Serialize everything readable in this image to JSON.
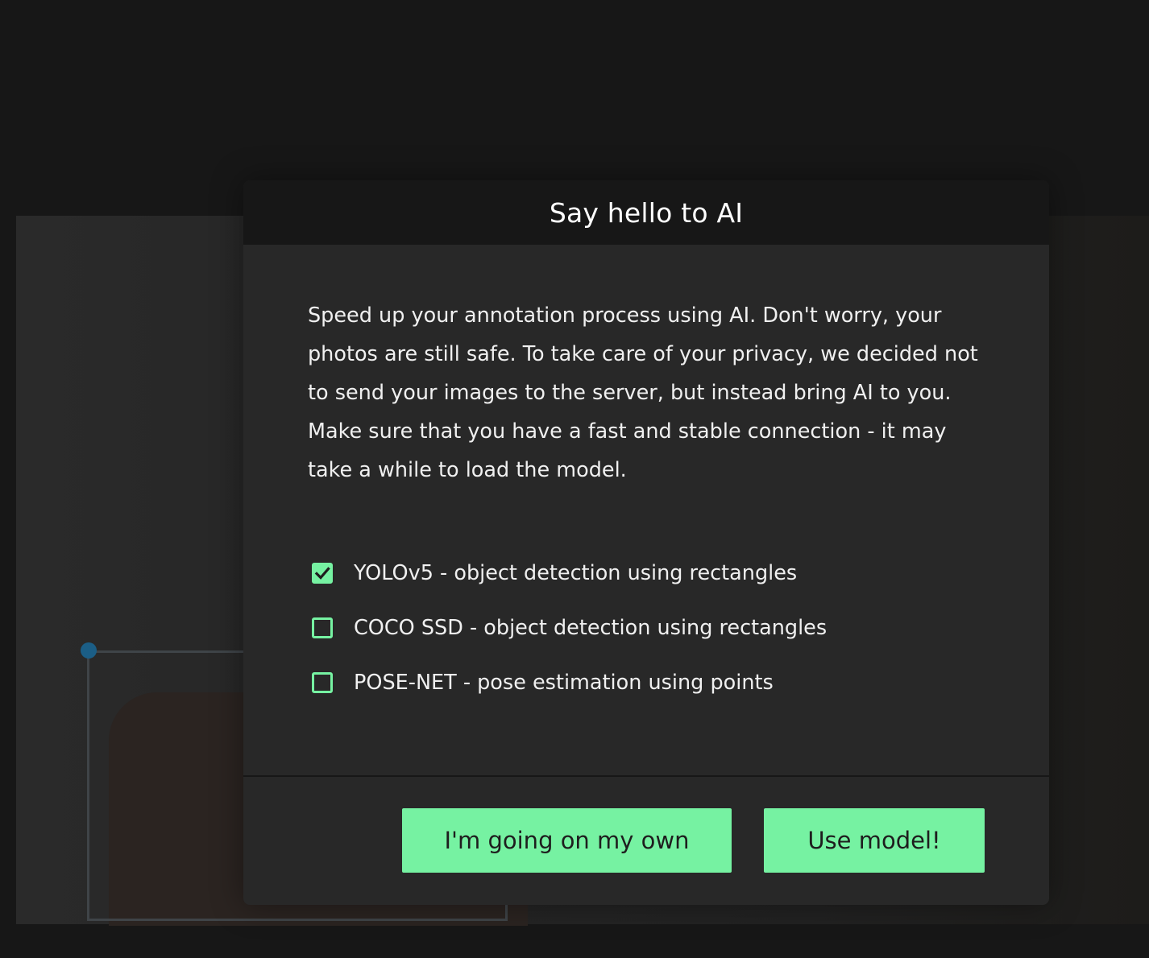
{
  "modal": {
    "title": "Say hello to AI",
    "description": "Speed up your annotation process using AI. Don't worry, your photos are still safe. To take care of your privacy, we decided not to send your images to the server, but instead bring AI to you. Make sure that you have a fast and stable connection - it may take a while to load the model.",
    "options": [
      {
        "label": "YOLOv5 - object detection using rectangles",
        "checked": true
      },
      {
        "label": "COCO SSD - object detection using rectangles",
        "checked": false
      },
      {
        "label": "POSE-NET - pose estimation using points",
        "checked": false
      }
    ],
    "buttons": {
      "own": "I'm going on my own",
      "use": "Use model!"
    }
  },
  "colors": {
    "accent": "#76f2a2",
    "modal_bg": "#282828",
    "header_bg": "#171717"
  }
}
